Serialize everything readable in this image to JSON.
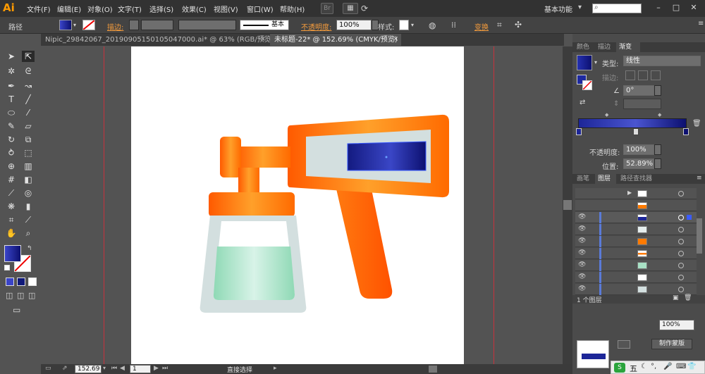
{
  "app": {
    "logo": "Ai"
  },
  "menu": [
    "文件(F)",
    "编辑(E)",
    "对象(O)",
    "文字(T)",
    "选择(S)",
    "效果(C)",
    "视图(V)",
    "窗口(W)",
    "帮助(H)"
  ],
  "menubar": {
    "br_label": "Br",
    "workspace": "基本功能",
    "workspace_arrow": "▾"
  },
  "control": {
    "selection_type": "路径",
    "stroke_label": "描边:",
    "stroke_style": "基本",
    "opacity_label": "不透明度:",
    "opacity_value": "100%",
    "style_label": "样式:",
    "transform_label": "变换"
  },
  "tabs": [
    {
      "label": "Nipic_29842067_20190905150105047000.ai* @ 63% (RGB/预览)",
      "active": false
    },
    {
      "label": "未标题-22* @ 152.69% (CMYK/预览)",
      "active": true
    }
  ],
  "colors": {
    "accent_orange": "#ff7a00",
    "gradient_start": "#3a44c8",
    "gradient_end": "#0c1070"
  },
  "gradient_panel": {
    "tabs": [
      "颜色",
      "描边",
      "渐变"
    ],
    "type_label": "类型:",
    "type_value": "线性",
    "stroke_label": "描边:",
    "angle_value": "0°",
    "opacity_label": "不透明度:",
    "opacity_value": "100%",
    "position_label": "位置:",
    "position_value": "52.89%"
  },
  "layers_panel": {
    "tabs": [
      "画笔",
      "图层",
      "路径查找器"
    ],
    "layer_count": "1 个图层",
    "row_count": 9
  },
  "bottom_panel": {
    "mask_button": "制作蒙版",
    "percent": "100%"
  },
  "status": {
    "zoom": "152.69",
    "page": "1",
    "tool": "直接选择"
  },
  "taskbar": {
    "ime": "五"
  }
}
